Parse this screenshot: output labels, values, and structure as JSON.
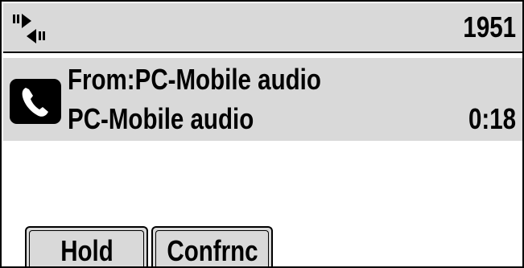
{
  "status_bar": {
    "icon": "speakerphone-icon",
    "line_number": "1951"
  },
  "call": {
    "icon": "phone-handset-icon",
    "from_line": "From:PC-Mobile audio",
    "caller_name": "PC-Mobile audio",
    "duration": "0:18"
  },
  "softkeys": {
    "hold_label": "Hold",
    "conference_label": "Confrnc"
  },
  "colors": {
    "panel_gray": "#d9d9d9",
    "foreground": "#000000",
    "background": "#ffffff"
  }
}
